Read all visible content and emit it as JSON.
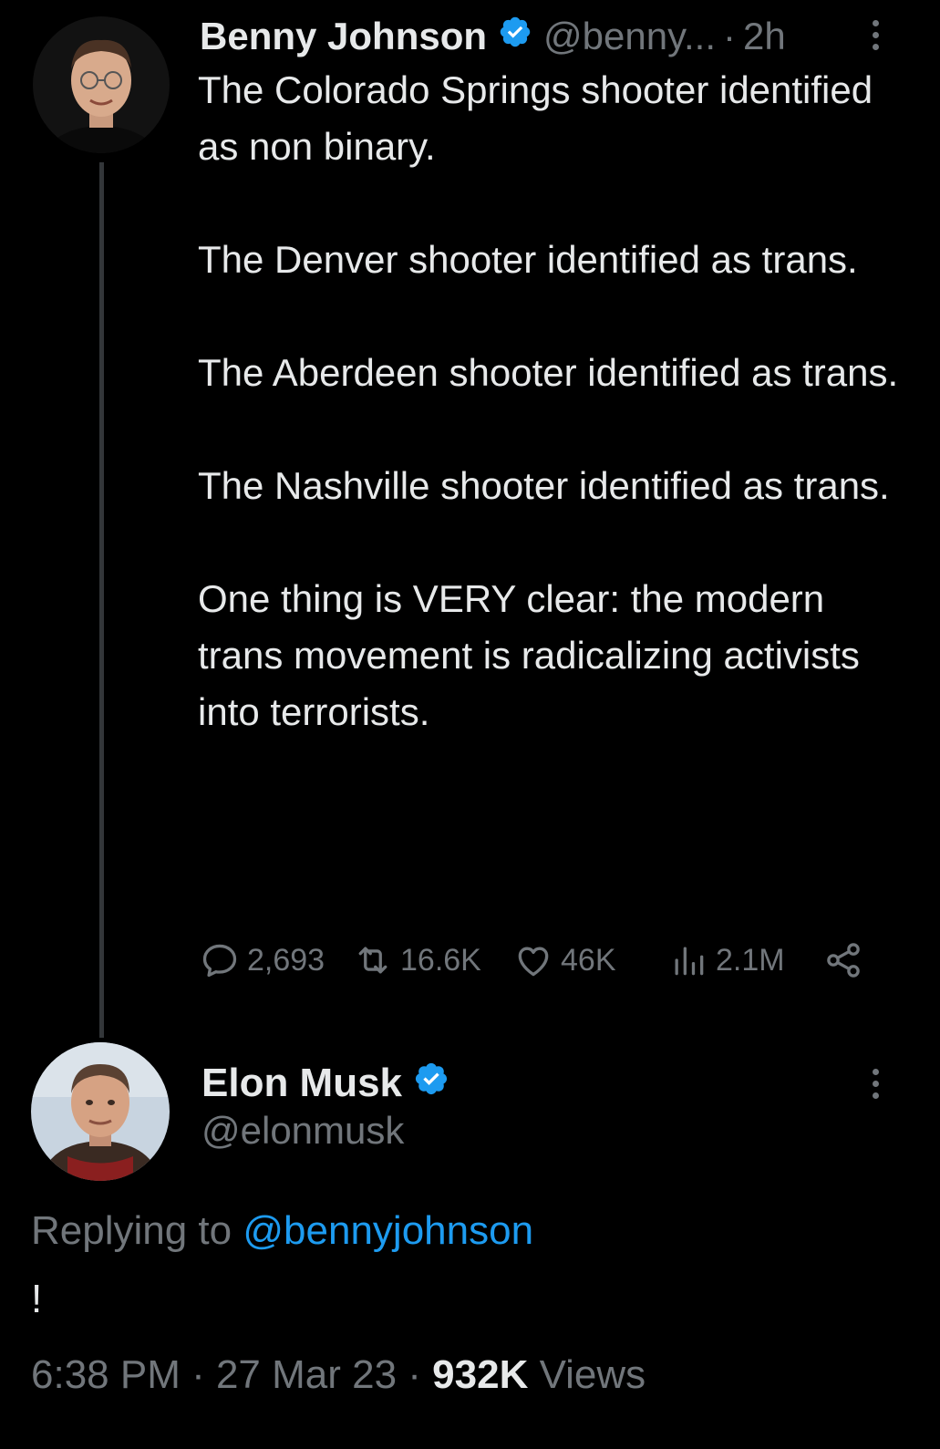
{
  "tweet": {
    "author": {
      "name": "Benny Johnson",
      "handle": "@benny...",
      "verified": true
    },
    "time": "2h",
    "paragraphs": [
      "The Colorado Springs shooter identified as non binary.",
      "The Denver shooter identified as trans.",
      "The Aberdeen shooter identified as trans.",
      "The Nashville shooter identified as trans.",
      "One thing is VERY clear: the modern trans movement is radicalizing activists into terrorists."
    ],
    "stats": {
      "replies": "2,693",
      "retweets": "16.6K",
      "likes": "46K",
      "views": "2.1M"
    }
  },
  "reply": {
    "author": {
      "name": "Elon Musk",
      "handle": "@elonmusk",
      "verified": true
    },
    "replying_prefix": "Replying to",
    "replying_to": "@bennyjohnson",
    "text": "!",
    "timestamp": "6:38 PM · 27 Mar 23 · ",
    "views_count": "932K",
    "views_label": "Views"
  },
  "colors": {
    "background": "#000000",
    "text": "#e7e9ea",
    "muted": "#71767b",
    "accent": "#1d9bf0"
  },
  "icons": [
    "verified-badge-icon",
    "more-icon",
    "reply-icon",
    "retweet-icon",
    "like-icon",
    "views-icon",
    "share-icon"
  ]
}
